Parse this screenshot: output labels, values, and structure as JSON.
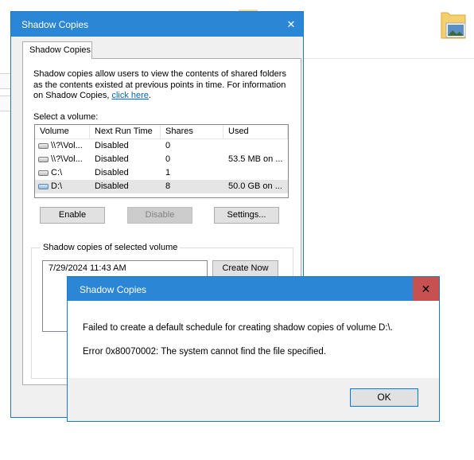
{
  "properties_dialog": {
    "title": "Shadow Copies",
    "tab_label": "Shadow Copies",
    "description": "Shadow copies allow users to view the contents of shared folders as the contents existed at previous points in time. For information on Shadow Copies, ",
    "link_text": "click here",
    "link_suffix": ".",
    "select_volume_label": "Select a volume:",
    "columns": [
      "Volume",
      "Next Run Time",
      "Shares",
      "Used"
    ],
    "volumes": [
      {
        "volume": "\\\\?\\Vol...",
        "next_run": "Disabled",
        "shares": "0",
        "used": "",
        "icon": "drive-icon",
        "selected": false
      },
      {
        "volume": "\\\\?\\Vol...",
        "next_run": "Disabled",
        "shares": "0",
        "used": "53.5 MB on ...",
        "icon": "drive-icon",
        "selected": false
      },
      {
        "volume": "C:\\",
        "next_run": "Disabled",
        "shares": "1",
        "used": "",
        "icon": "drive-icon",
        "selected": false
      },
      {
        "volume": "D:\\",
        "next_run": "Disabled",
        "shares": "8",
        "used": "50.0 GB on ...",
        "icon": "drive-icon",
        "selected": true
      }
    ],
    "enable_label": "Enable",
    "disable_label": "Disable",
    "settings_label": "Settings...",
    "group_label": "Shadow copies of selected volume",
    "shadow_copies": [
      "7/29/2024 11:43 AM"
    ],
    "create_now_label": "Create Now"
  },
  "error_dialog": {
    "title": "Shadow Copies",
    "close_glyph": "✕",
    "message": "Failed to create a default schedule for creating shadow copies of volume D:\\.",
    "error": "Error 0x80070002: The system cannot find the file specified.",
    "ok_label": "OK"
  },
  "colors": {
    "title_bar": "#2b87d6",
    "close_hover": "#c75050",
    "selected_row": "#e5e5e5"
  }
}
